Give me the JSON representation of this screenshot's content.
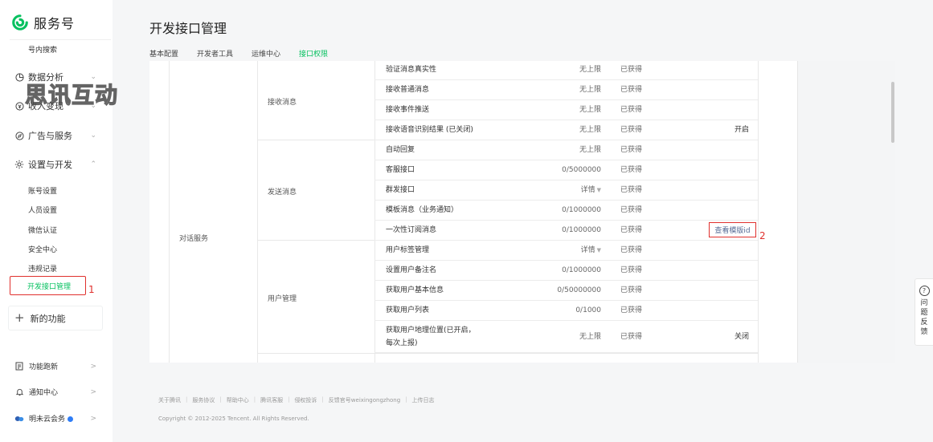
{
  "sidebar": {
    "logo_text": "服务号",
    "sub_items_top": [
      "号内搜索"
    ],
    "groups": [
      {
        "label": "数据分析",
        "icon": "chart-icon"
      },
      {
        "label": "收入变现",
        "icon": "money-icon"
      },
      {
        "label": "广告与服务",
        "icon": "compass-icon"
      },
      {
        "label": "设置与开发",
        "icon": "settings-icon"
      }
    ],
    "settings_items": [
      "账号设置",
      "人员设置",
      "微信认证",
      "安全中心",
      "违规记录",
      "开发接口管理"
    ],
    "new_func": "新的功能",
    "bottom": [
      {
        "label": "功能跑新",
        "icon": "list-icon"
      },
      {
        "label": "通知中心",
        "icon": "bell-icon"
      },
      {
        "label": "明未云会务",
        "icon": "avatar-icon"
      }
    ]
  },
  "watermark": "思讯互动",
  "annotations": {
    "first": "1",
    "second": "2"
  },
  "page_title": "开发接口管理",
  "tabs": [
    "基本配置",
    "开发者工具",
    "运维中心",
    "接口权限"
  ],
  "active_tab_index": 3,
  "table": {
    "category": "对话服务",
    "groups": [
      {
        "label": "接收消息"
      },
      {
        "label": "发送消息"
      },
      {
        "label": "用户管理"
      }
    ],
    "rows": [
      {
        "name": "验证消息真实性",
        "limit": "无上限",
        "status": "已获得",
        "action": ""
      },
      {
        "name": "接收普通消息",
        "limit": "无上限",
        "status": "已获得",
        "action": ""
      },
      {
        "name": "接收事件推送",
        "limit": "无上限",
        "status": "已获得",
        "action": ""
      },
      {
        "name": "接收语音识别结果 (已关闭)",
        "limit": "无上限",
        "status": "已获得",
        "action": "开启"
      },
      {
        "name": "自动回复",
        "limit": "无上限",
        "status": "已获得",
        "action": ""
      },
      {
        "name": "客服接口",
        "limit": "0/5000000",
        "status": "已获得",
        "action": ""
      },
      {
        "name": "群发接口",
        "limit": "详情",
        "status": "已获得",
        "action": ""
      },
      {
        "name": "模板消息（业务通知）",
        "limit": "0/1000000",
        "status": "已获得",
        "action": ""
      },
      {
        "name": "一次性订阅消息",
        "limit": "0/1000000",
        "status": "已获得",
        "action": "查看模版id"
      },
      {
        "name": "用户标签管理",
        "limit": "详情",
        "status": "已获得",
        "action": ""
      },
      {
        "name": "设置用户备注名",
        "limit": "0/1000000",
        "status": "已获得",
        "action": ""
      },
      {
        "name": "获取用户基本信息",
        "limit": "0/50000000",
        "status": "已获得",
        "action": ""
      },
      {
        "name": "获取用户列表",
        "limit": "0/1000",
        "status": "已获得",
        "action": ""
      },
      {
        "name": "获取用户地理位置(已开启，每次上报)",
        "limit": "无上限",
        "status": "已获得",
        "action": "关闭"
      }
    ]
  },
  "footer": {
    "links": [
      "关于腾讯",
      "服务协议",
      "帮助中心",
      "腾讯客服",
      "侵权投诉",
      "反馈官号weixingongzhong",
      "上传日志"
    ],
    "copyright": "Copyright © 2012-2025 Tencent. All Rights Reserved."
  },
  "feedback": {
    "icon": "question-icon",
    "label": "问题反馈"
  },
  "colors": {
    "accent": "#07c160",
    "highlight_box": "#e0302d",
    "link": "#576b95"
  }
}
